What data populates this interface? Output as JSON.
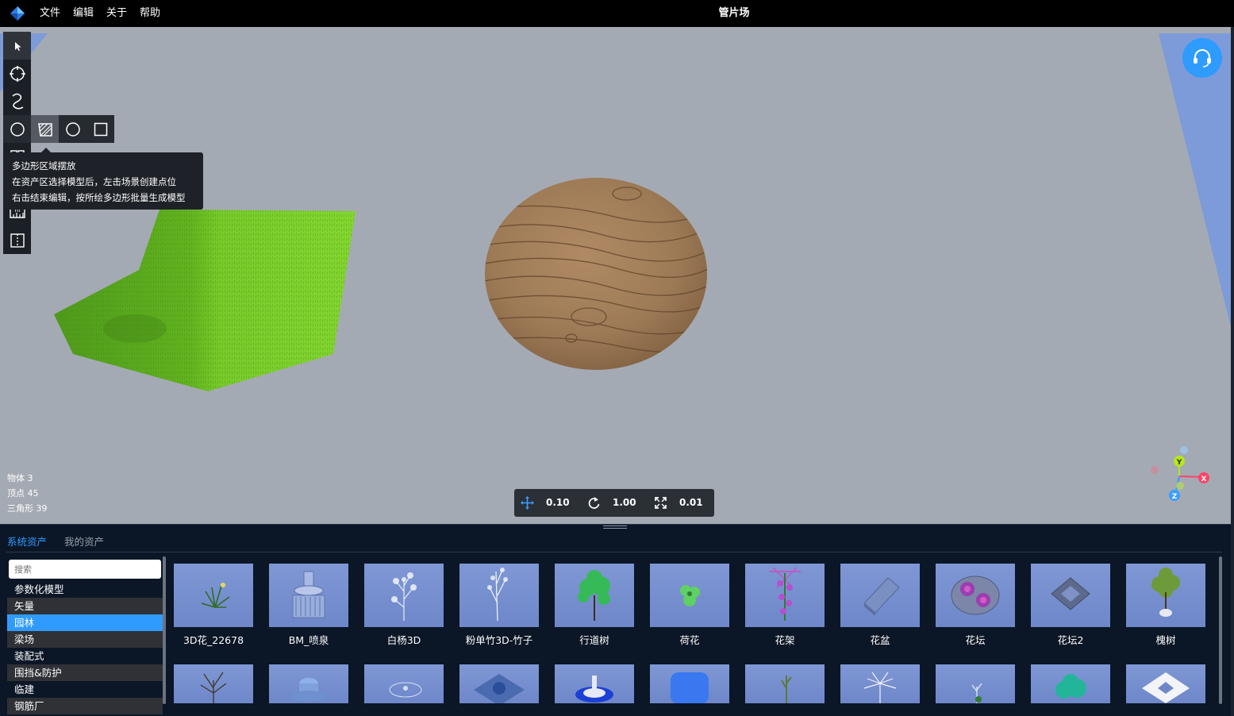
{
  "menubar": {
    "logo_icon": "app-logo-diamond",
    "menus": [
      "文件",
      "编辑",
      "关于",
      "帮助"
    ],
    "title": "管片场"
  },
  "toolbar": {
    "tools": [
      "select-arrow-icon",
      "circle-target-icon",
      "curve-icon",
      "polygon-area-icon",
      "grid-icon",
      "measure-icon",
      "split-view-icon"
    ],
    "subtools": [
      "circle-place-icon",
      "polygon-area-place-icon",
      "circle-outline-icon",
      "square-outline-icon"
    ]
  },
  "tooltip": {
    "title": "多边形区域摆放",
    "line1": "在资产区选择模型后，左击场景创建点位",
    "line2": "右击结束编辑，按所绘多边形批量生成模型"
  },
  "stats": {
    "objects": "物体 3",
    "vertices": "顶点 45",
    "triangles": "三角形 39"
  },
  "transform": {
    "move": "0.10",
    "rotate": "1.00",
    "scale": "0.01"
  },
  "axes": {
    "x": "X",
    "y": "Y",
    "z": "Z"
  },
  "colors": {
    "accent": "#2f9bff",
    "viewport_bg": "#a4aab3",
    "panel_bg": "#0b1626",
    "axis_x": "#ff4466",
    "axis_y": "#b5e61d",
    "axis_z": "#3b9dff"
  },
  "assets_panel": {
    "tabs": [
      "系统资产",
      "我的资产"
    ],
    "search_placeholder": "搜索",
    "categories": [
      "参数化模型",
      "矢量",
      "园林",
      "梁场",
      "装配式",
      "围挡&防护",
      "临建",
      "钢筋厂"
    ],
    "selected_category": "园林",
    "row1": [
      "3D花_22678",
      "BM_喷泉",
      "白杨3D",
      "粉单竹3D-竹子",
      "行道树",
      "荷花",
      "花架",
      "花盆",
      "花坛",
      "花坛2",
      "槐树"
    ]
  }
}
